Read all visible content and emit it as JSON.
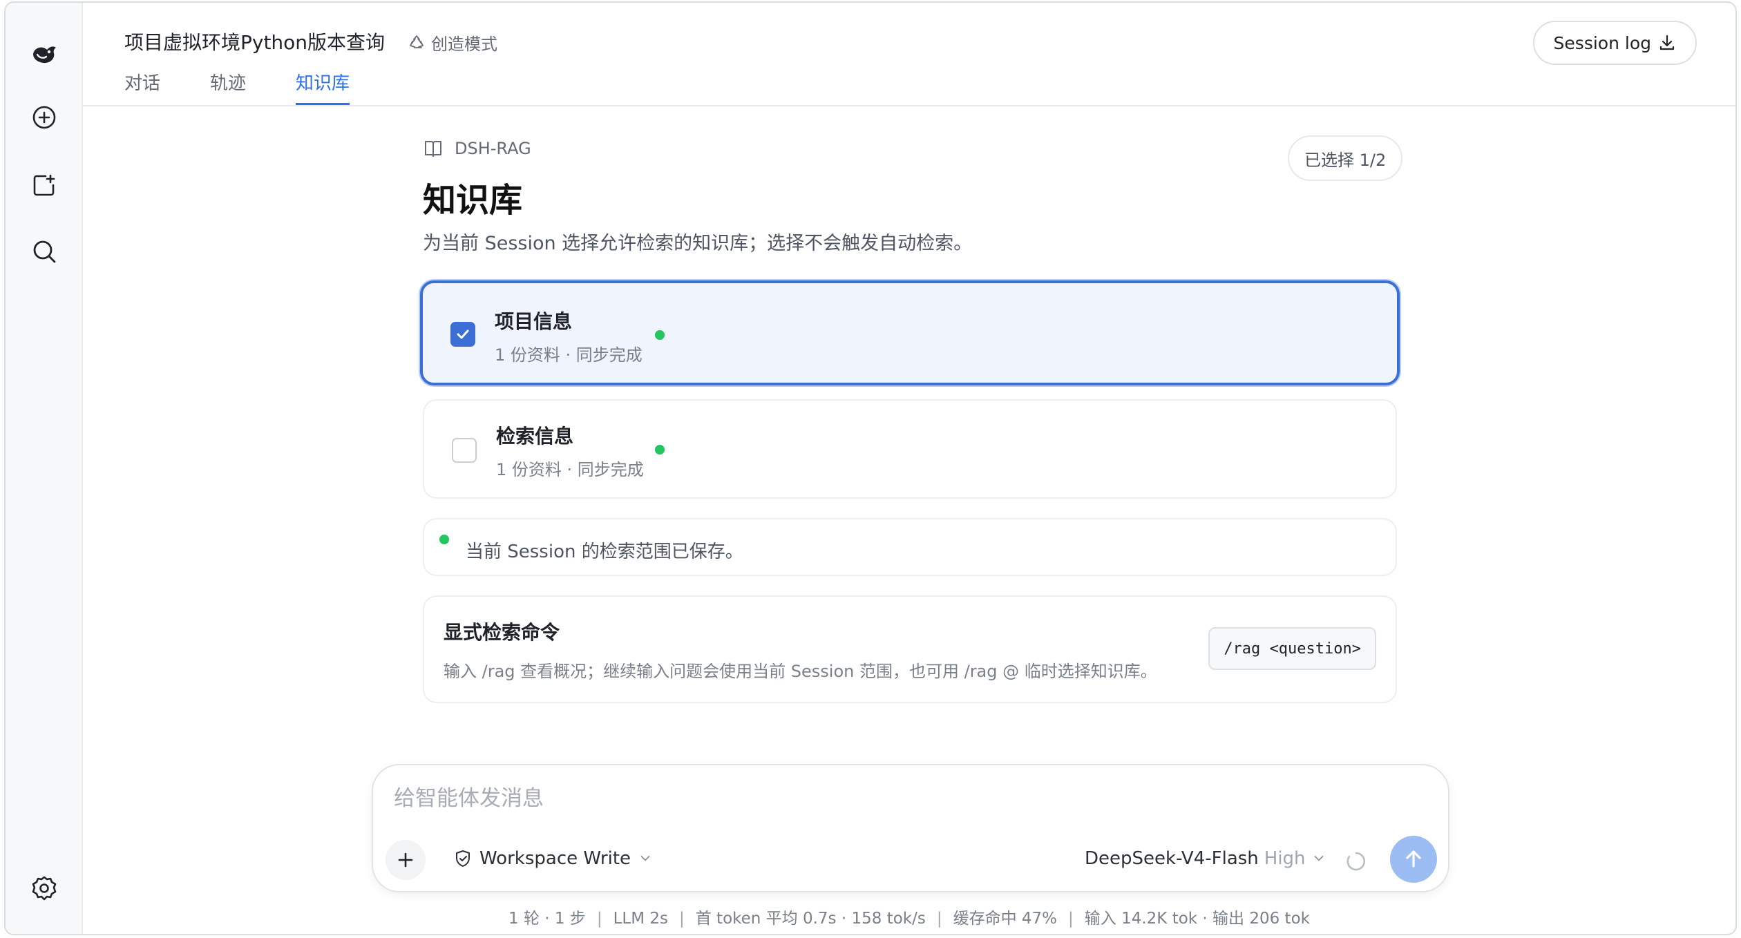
{
  "header": {
    "title": "项目虚拟环境Python版本查询",
    "mode_label": "创造模式",
    "session_log_label": "Session log",
    "tabs": [
      {
        "label": "对话",
        "active": false
      },
      {
        "label": "轨迹",
        "active": false
      },
      {
        "label": "知识库",
        "active": true
      }
    ]
  },
  "sidebar": {
    "icons": [
      "logo-icon",
      "new-chat-icon",
      "new-window-icon",
      "search-icon",
      "settings-icon"
    ]
  },
  "knowledge": {
    "breadcrumb": "DSH-RAG",
    "title": "知识库",
    "description": "为当前 Session 选择允许检索的知识库；选择不会触发自动检索。",
    "selected_badge": "已选择 1/2",
    "items": [
      {
        "name": "项目信息",
        "meta": "1 份资料 · 同步完成",
        "checked": true
      },
      {
        "name": "检索信息",
        "meta": "1 份资料 · 同步完成",
        "checked": false
      }
    ],
    "notice": "当前 Session 的检索范围已保存。",
    "command": {
      "title": "显式检索命令",
      "description": "输入 /rag 查看概况；继续输入问题会使用当前 Session 范围，也可用 /rag @ 临时选择知识库。",
      "chip": "/rag <question>"
    }
  },
  "composer": {
    "placeholder": "给智能体发消息",
    "workspace_label": "Workspace Write",
    "model_name": "DeepSeek-V4-Flash",
    "model_level": "High"
  },
  "stats": {
    "turns": "1 轮 · 1 步",
    "llm": "LLM 2s",
    "token_speed": "首 token 平均 0.7s · 158 tok/s",
    "cache": "缓存命中 47%",
    "io": "输入 14.2K tok · 输出 206 tok"
  },
  "colors": {
    "accent": "#2c6ff0",
    "checkbox": "#3c6fd6",
    "status_ok": "#22c55e",
    "send_button": "#9cbcf4"
  }
}
